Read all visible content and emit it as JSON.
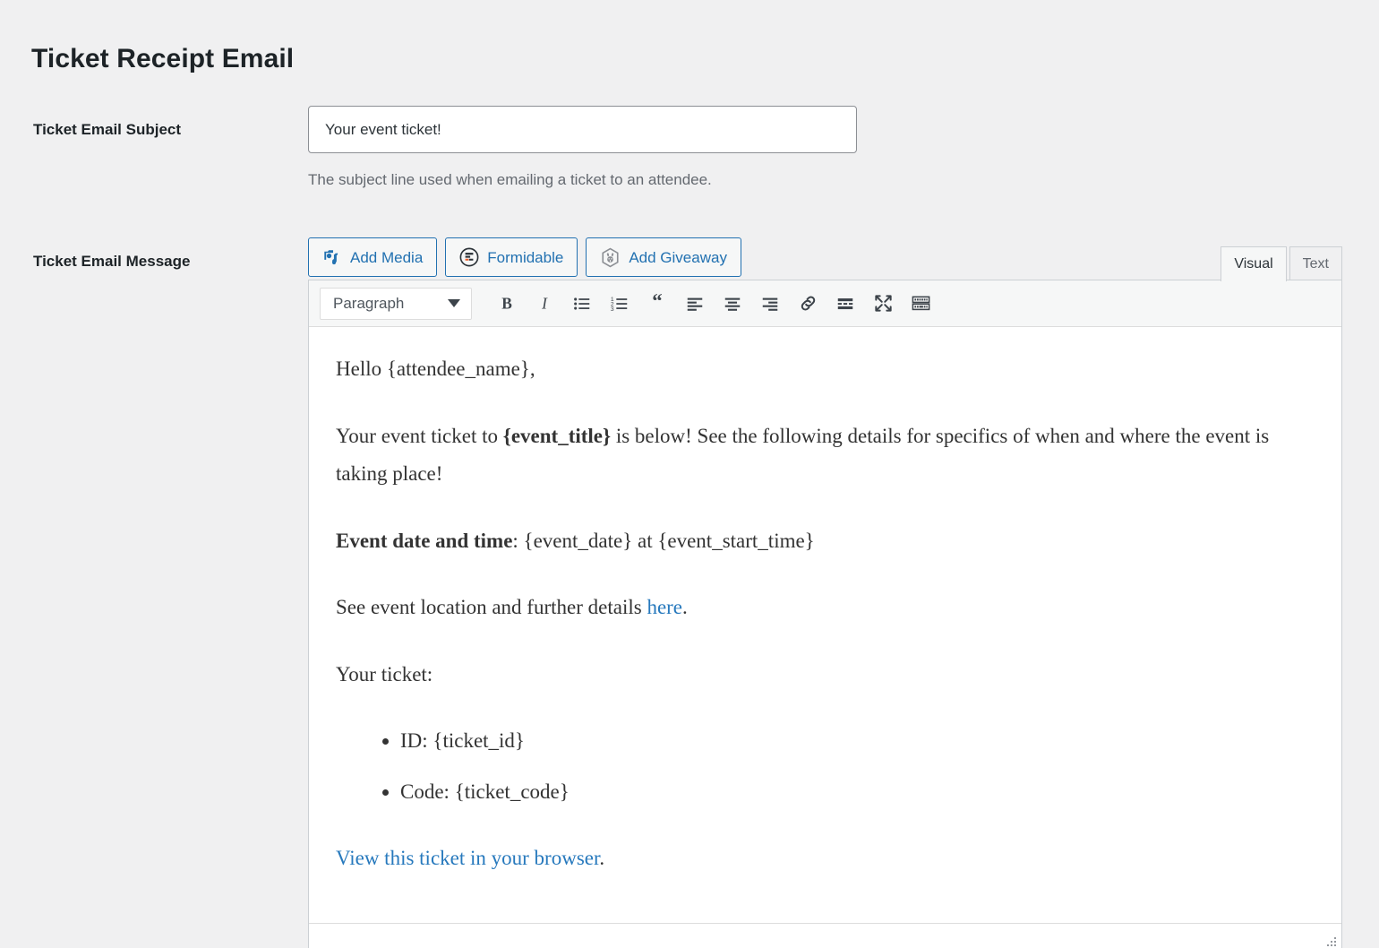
{
  "page": {
    "title": "Ticket Receipt Email"
  },
  "fields": {
    "subject": {
      "label": "Ticket Email Subject",
      "value": "Your event ticket!",
      "placeholder": "Your event ticket!",
      "help": "The subject line used when emailing a ticket to an attendee."
    },
    "message": {
      "label": "Ticket Email Message"
    }
  },
  "media_buttons": [
    {
      "label": "Add Media",
      "icon": "add-media-icon"
    },
    {
      "label": "Formidable",
      "icon": "formidable-icon"
    },
    {
      "label": "Add Giveaway",
      "icon": "rabbit-hexagon-icon"
    }
  ],
  "editor_tabs": [
    {
      "label": "Visual",
      "active": true
    },
    {
      "label": "Text",
      "active": false
    }
  ],
  "toolbar": {
    "format_select": "Paragraph",
    "buttons": [
      {
        "name": "bold",
        "title": "Bold"
      },
      {
        "name": "italic",
        "title": "Italic"
      },
      {
        "name": "bullist",
        "title": "Bulleted list"
      },
      {
        "name": "numlist",
        "title": "Numbered list"
      },
      {
        "name": "blockquote",
        "title": "Blockquote"
      },
      {
        "name": "alignleft",
        "title": "Align left"
      },
      {
        "name": "aligncenter",
        "title": "Align center"
      },
      {
        "name": "alignright",
        "title": "Align right"
      },
      {
        "name": "link",
        "title": "Insert/edit link"
      },
      {
        "name": "readmore",
        "title": "Insert Read More tag"
      },
      {
        "name": "fullscreen",
        "title": "Distraction-free writing mode"
      },
      {
        "name": "kitchensink",
        "title": "Toolbar Toggle"
      }
    ]
  },
  "content": {
    "greeting": "Hello {attendee_name},",
    "intro_before": "Your event ticket to ",
    "intro_bold": "{event_title}",
    "intro_after": " is below! See the following details for specifics of when and where the event is taking place!",
    "date_label": "Event date and time",
    "date_value": ": {event_date} at {event_start_time}",
    "location_before": "See event location and further details ",
    "location_link": "here",
    "location_after": ".",
    "ticket_heading": "Your ticket:",
    "ticket_items": [
      "ID: {ticket_id}",
      "Code: {ticket_code}"
    ],
    "browser_link": "View this ticket in your browser",
    "browser_link_after": "."
  },
  "colors": {
    "page_background": "#f0f0f1",
    "accent_blue": "#2271b1",
    "link_blue": "#2779bd",
    "text_dark": "#1d2327",
    "help_text": "#646970",
    "border": "#ccd0d4",
    "formidable_orange": "#f05a24",
    "giveaway_gray": "#8c8f94"
  }
}
